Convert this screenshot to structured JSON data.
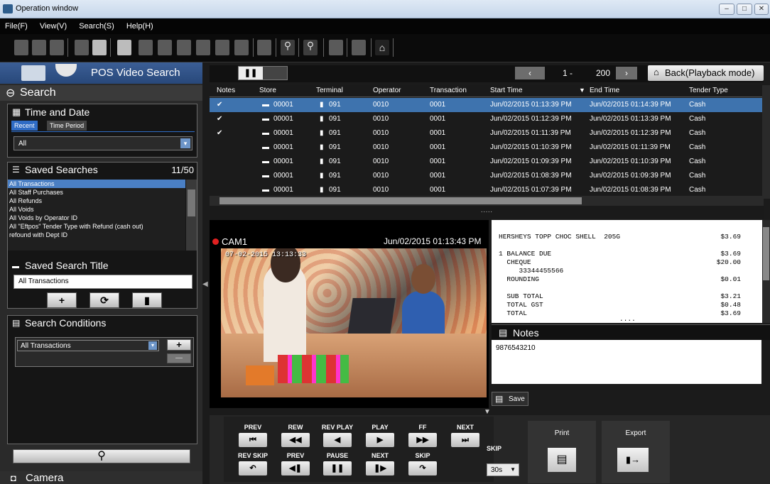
{
  "window": {
    "title": "Operation window"
  },
  "menu": [
    "File(F)",
    "View(V)",
    "Search(S)",
    "Help(H)"
  ],
  "left": {
    "pos_title": "POS Video Search",
    "search_title": "Search",
    "time_date": {
      "title": "Time and Date",
      "tabs": [
        "Recent",
        "Time Period"
      ],
      "select_value": "All"
    },
    "saved_searches": {
      "title": "Saved Searches",
      "count": "11/50",
      "items": [
        "All Transactions",
        "All Staff Purchases",
        "All Refunds",
        "All Voids",
        "All Voids by Operator ID",
        "All \"Eftpos\" Tender Type with Refund (cash out)",
        "refound with Dept ID"
      ]
    },
    "saved_title": {
      "title": "Saved Search Title",
      "value": "All Transactions"
    },
    "conditions": {
      "title": "Search Conditions",
      "select_value": "All Transactions"
    },
    "camera_title": "Camera"
  },
  "pager": {
    "start": "1 -",
    "end": "200",
    "back_label": "Back(Playback mode)"
  },
  "grid": {
    "columns": [
      "Notes",
      "Store",
      "Terminal",
      "Operator",
      "Transaction",
      "Start Time",
      "End Time",
      "Tender Type"
    ],
    "rows": [
      {
        "note": "✔",
        "store": "00001",
        "terminal": "091",
        "operator": "0010",
        "transaction": "0001",
        "start": "Jun/02/2015 01:13:39 PM",
        "end": "Jun/02/2015 01:14:39 PM",
        "tender": "Cash"
      },
      {
        "note": "✔",
        "store": "00001",
        "terminal": "091",
        "operator": "0010",
        "transaction": "0001",
        "start": "Jun/02/2015 01:12:39 PM",
        "end": "Jun/02/2015 01:13:39 PM",
        "tender": "Cash"
      },
      {
        "note": "✔",
        "store": "00001",
        "terminal": "091",
        "operator": "0010",
        "transaction": "0001",
        "start": "Jun/02/2015 01:11:39 PM",
        "end": "Jun/02/2015 01:12:39 PM",
        "tender": "Cash"
      },
      {
        "note": "",
        "store": "00001",
        "terminal": "091",
        "operator": "0010",
        "transaction": "0001",
        "start": "Jun/02/2015 01:10:39 PM",
        "end": "Jun/02/2015 01:11:39 PM",
        "tender": "Cash"
      },
      {
        "note": "",
        "store": "00001",
        "terminal": "091",
        "operator": "0010",
        "transaction": "0001",
        "start": "Jun/02/2015 01:09:39 PM",
        "end": "Jun/02/2015 01:10:39 PM",
        "tender": "Cash"
      },
      {
        "note": "",
        "store": "00001",
        "terminal": "091",
        "operator": "0010",
        "transaction": "0001",
        "start": "Jun/02/2015 01:08:39 PM",
        "end": "Jun/02/2015 01:09:39 PM",
        "tender": "Cash"
      },
      {
        "note": "",
        "store": "00001",
        "terminal": "091",
        "operator": "0010",
        "transaction": "0001",
        "start": "Jun/02/2015 01:07:39 PM",
        "end": "Jun/02/2015 01:08:39 PM",
        "tender": "Cash"
      }
    ]
  },
  "video": {
    "camera": "CAM1",
    "timestamp": "Jun/02/2015 01:13:43 PM",
    "overlay": "07-02-2015  13:13:33"
  },
  "receipt": {
    "lines": [
      {
        "left": "HERSHEYS TOPP CHOC SHELL  205G",
        "right": "$3.69"
      },
      {
        "left": "1 BALANCE DUE",
        "right": "$3.69"
      },
      {
        "left": "  CHEQUE",
        "right": "$20.00"
      },
      {
        "left": "     33344455566",
        "right": ""
      },
      {
        "left": "  ROUNDING",
        "right": "$0.01"
      },
      {
        "left": "  SUB TOTAL",
        "right": "$3.21"
      },
      {
        "left": "  TOTAL GST",
        "right": "$0.48"
      },
      {
        "left": "  TOTAL",
        "right": "$3.69"
      }
    ]
  },
  "notes": {
    "title": "Notes",
    "value": "9876543210",
    "save_label": "Save"
  },
  "playback": {
    "top_labels": [
      "PREV",
      "REW",
      "REV PLAY",
      "PLAY",
      "FF",
      "NEXT"
    ],
    "bottom_labels": [
      "REV SKIP",
      "PREV",
      "PAUSE",
      "NEXT",
      "SKIP"
    ],
    "skip_label": "SKIP",
    "skip_value": "30s",
    "print_label": "Print",
    "export_label": "Export"
  }
}
